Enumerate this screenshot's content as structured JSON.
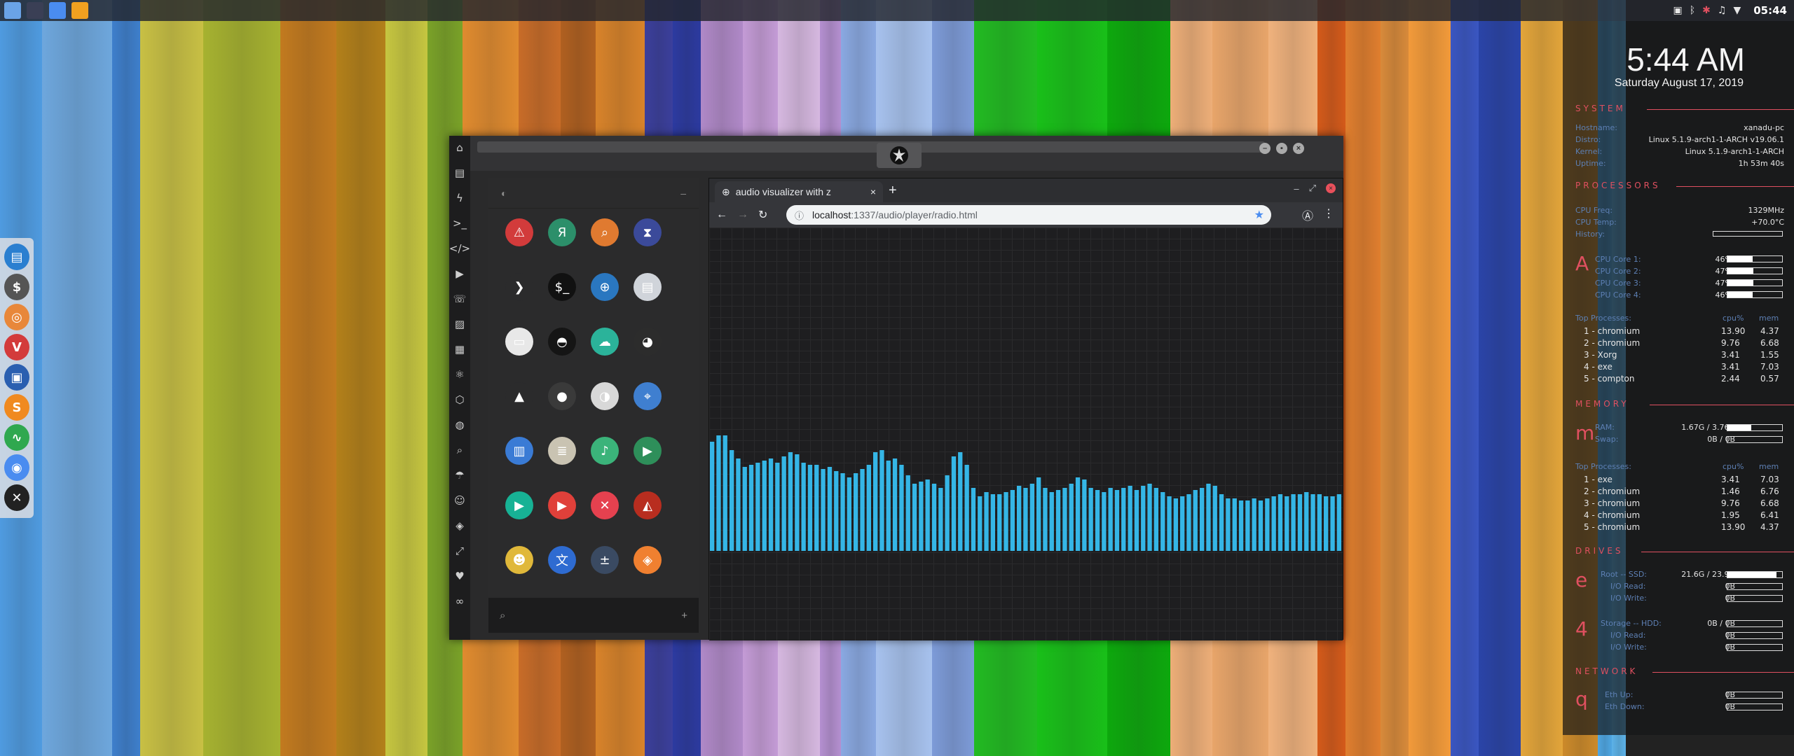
{
  "wallpaper": {
    "stripes": [
      "#4f9be0",
      "#6ea7dd",
      "#3e7fcc",
      "#c8c044",
      "#a6b230",
      "#c27a1f",
      "#b3801a",
      "#c6c640",
      "#7aa228",
      "#e08b2f",
      "#c86c28",
      "#b06020",
      "#d8832a",
      "#3b3f9c",
      "#2c3aa0",
      "#b089c8",
      "#c49bd6",
      "#d6b8e0",
      "#b48fd0",
      "#8aa9e2",
      "#a7c2ee",
      "#7d9bd8",
      "#22bb22",
      "#19c019",
      "#0da80d",
      "#edae78",
      "#e8a56a",
      "#f0b27d",
      "#d45a1a",
      "#e07e2e",
      "#d88a3a",
      "#f29a3a",
      "#3a56c2",
      "#2a44a8",
      "#e3a53a",
      "#cc8a2a",
      "#4ea6e2",
      "#5cb2e8"
    ]
  },
  "top_panel": {
    "apps": [
      {
        "icon": "folder-icon",
        "color": "#6aa3e6"
      },
      {
        "icon": "circle-app-icon",
        "color": "#3a3f55"
      },
      {
        "icon": "chrome-icon",
        "color": "#4a8cf0"
      },
      {
        "icon": "sublime-icon",
        "color": "#f0a020"
      }
    ],
    "tray": [
      "screenshot-icon",
      "bluetooth-icon",
      "settings-icon",
      "volume-icon",
      "wifi-icon"
    ],
    "clock": "05:44"
  },
  "dock": {
    "items": [
      {
        "icon": "files-icon",
        "color": "#2a7fd0",
        "glyph": "▤"
      },
      {
        "icon": "money-icon",
        "color": "#555555",
        "glyph": "$"
      },
      {
        "icon": "ubuntu-icon",
        "color": "#e8873a",
        "glyph": "◎"
      },
      {
        "icon": "vivaldi-icon",
        "color": "#d33b3b",
        "glyph": "V"
      },
      {
        "icon": "screenshot-app-icon",
        "color": "#2a5fb0",
        "glyph": "▣"
      },
      {
        "icon": "sublime-text-icon",
        "color": "#f08a20",
        "glyph": "S"
      },
      {
        "icon": "activity-monitor-icon",
        "color": "#2fa84f",
        "glyph": "∿"
      },
      {
        "icon": "chromium-icon",
        "color": "#4a8cf0",
        "glyph": "◉"
      },
      {
        "icon": "x-app-icon",
        "color": "#222222",
        "glyph": "✕"
      }
    ]
  },
  "conky": {
    "time": "5:44 AM",
    "date": "Saturday August 17, 2019",
    "system": {
      "header": "SYSTEM",
      "rows": [
        {
          "label": "Hostname:",
          "value": "xanadu-pc"
        },
        {
          "label": "Distro:",
          "value": "Linux 5.1.9-arch1-1-ARCH v19.06.1"
        },
        {
          "label": "Kernel:",
          "value": "Linux 5.1.9-arch1-1-ARCH"
        },
        {
          "label": "Uptime:",
          "value": "1h 53m 40s"
        }
      ]
    },
    "processors": {
      "header": "PROCESSORS",
      "freq_label": "CPU Freq:",
      "freq": "1329MHz",
      "temp_label": "CPU Temp:",
      "temp": "+70.0°C",
      "history_label": "History:",
      "big": "A",
      "cores": [
        {
          "label": "CPU Core 1:",
          "value": "46%",
          "level": 0.46
        },
        {
          "label": "CPU Core 2:",
          "value": "47%",
          "level": 0.47
        },
        {
          "label": "CPU Core 3:",
          "value": "47%",
          "level": 0.47
        },
        {
          "label": "CPU Core 4:",
          "value": "46%",
          "level": 0.46
        }
      ],
      "top_label": "Top Processes:",
      "col1": "cpu%",
      "col2": "mem",
      "procs": [
        {
          "n": "1",
          "name": "chromium",
          "a": "13.90",
          "b": "4.37"
        },
        {
          "n": "2",
          "name": "chromium",
          "a": "9.76",
          "b": "6.68"
        },
        {
          "n": "3",
          "name": "Xorg",
          "a": "3.41",
          "b": "1.55"
        },
        {
          "n": "4",
          "name": "exe",
          "a": "3.41",
          "b": "7.03"
        },
        {
          "n": "5",
          "name": "compton",
          "a": "2.44",
          "b": "0.57"
        }
      ]
    },
    "memory": {
      "header": "MEMORY",
      "big": "m",
      "ram_label": "RAM:",
      "ram": "1.67G / 3.76G",
      "ram_level": 0.44,
      "swap_label": "Swap:",
      "swap": "0B / 0B",
      "swap_level": 0,
      "top_label": "Top Processes:",
      "col1": "cpu%",
      "col2": "mem",
      "procs": [
        {
          "n": "1",
          "name": "exe",
          "a": "3.41",
          "b": "7.03"
        },
        {
          "n": "2",
          "name": "chromium",
          "a": "1.46",
          "b": "6.76"
        },
        {
          "n": "3",
          "name": "chromium",
          "a": "9.76",
          "b": "6.68"
        },
        {
          "n": "4",
          "name": "chromium",
          "a": "1.95",
          "b": "6.41"
        },
        {
          "n": "5",
          "name": "chromium",
          "a": "13.90",
          "b": "4.37"
        }
      ]
    },
    "drives": {
      "header": "DRIVES",
      "d1": {
        "big": "e",
        "label": "Root -- SSD:",
        "value": "21.6G / 23.9G",
        "level": 0.9,
        "read_label": "I/O Read:",
        "read": "0B",
        "write_label": "I/O Write:",
        "write": "0B"
      },
      "d2": {
        "big": "4",
        "label": "Storage -- HDD:",
        "value": "0B / 0B",
        "level": 0,
        "read_label": "I/O Read:",
        "read": "0B",
        "write_label": "I/O Write:",
        "write": "0B"
      }
    },
    "network": {
      "header": "NETWORK",
      "big": "q",
      "up_label": "Eth Up:",
      "up": "0B",
      "down_label": "Eth Down:",
      "down": "0B"
    }
  },
  "window": {
    "side_icons": [
      "home-icon",
      "document-icon",
      "bolt-icon",
      "terminal-icon",
      "code-icon",
      "play-icon",
      "contacts-icon",
      "image-icon",
      "news-icon",
      "atom-icon",
      "hexagon-icon",
      "globe-icon",
      "search-icon",
      "umbrella-icon",
      "person-icon",
      "diamond-icon",
      "expand-icon",
      "heart-icon",
      "infinity-icon"
    ],
    "launcher": {
      "top_icon": "◐",
      "top_minus": "–",
      "icons": [
        {
          "name": "warning-app-icon",
          "bg": "#d23b3b",
          "glyph": "⚠"
        },
        {
          "name": "yandex-icon",
          "bg": "#2c8f6a",
          "glyph": "Я"
        },
        {
          "name": "magnifier-app-icon",
          "bg": "#e07a30",
          "glyph": "⌕"
        },
        {
          "name": "hourglass-icon",
          "bg": "#3b4a9a",
          "glyph": "⧗"
        },
        {
          "name": "sublime-launcher-icon",
          "bg": "#2b2b2c",
          "glyph": "❯"
        },
        {
          "name": "terminal-app-icon",
          "bg": "#111111",
          "glyph": "$_"
        },
        {
          "name": "globe-app-icon",
          "bg": "#2a77c0",
          "glyph": "⊕"
        },
        {
          "name": "server-icon",
          "bg": "#d0d4da",
          "glyph": "▤"
        },
        {
          "name": "window-app-icon",
          "bg": "#e8e8e8",
          "glyph": "▭"
        },
        {
          "name": "darth-vader-icon",
          "bg": "#151515",
          "glyph": "◓"
        },
        {
          "name": "cloud-lock-icon",
          "bg": "#2bb39a",
          "glyph": "☁"
        },
        {
          "name": "github-icon",
          "bg": "#2c2c2c",
          "glyph": "◕"
        },
        {
          "name": "starfleet-icon",
          "bg": "#2b2b2c",
          "glyph": "▲"
        },
        {
          "name": "death-star-icon",
          "bg": "#3a3a3a",
          "glyph": "●"
        },
        {
          "name": "moon-icon",
          "bg": "#d8d8d8",
          "glyph": "◑"
        },
        {
          "name": "map-icon",
          "bg": "#3f7fd0",
          "glyph": "⌖"
        },
        {
          "name": "archive-icon",
          "bg": "#3a7bd5",
          "glyph": "▥"
        },
        {
          "name": "notes-icon",
          "bg": "#c9c3b2",
          "glyph": "≣"
        },
        {
          "name": "music-icon",
          "bg": "#3bb37a",
          "glyph": "♪"
        },
        {
          "name": "video-icon",
          "bg": "#2e8f5a",
          "glyph": "▶"
        },
        {
          "name": "play-store-icon",
          "bg": "#17b295",
          "glyph": "▶"
        },
        {
          "name": "youtube-icon",
          "bg": "#e0403a",
          "glyph": "▶"
        },
        {
          "name": "close-app-icon",
          "bg": "#e5414f",
          "glyph": "✕"
        },
        {
          "name": "iron-man-icon",
          "bg": "#b82d1f",
          "glyph": "◭"
        },
        {
          "name": "c3po-icon",
          "bg": "#e0b83a",
          "glyph": "☻"
        },
        {
          "name": "translate-icon",
          "bg": "#2e6bd1",
          "glyph": "文"
        },
        {
          "name": "calculator-icon",
          "bg": "#3a4a62",
          "glyph": "±"
        },
        {
          "name": "photos-icon",
          "bg": "#f08030",
          "glyph": "◈"
        }
      ],
      "search_icon": "⌕",
      "search_plus": "+"
    },
    "browser": {
      "tab_title": "audio visualizer with z",
      "tab_close": "×",
      "new_tab": "+",
      "url_host": "localhost",
      "url_path": ":1337/audio/player/radio.html",
      "bars": [
        0.52,
        0.55,
        0.55,
        0.48,
        0.44,
        0.4,
        0.41,
        0.42,
        0.43,
        0.44,
        0.42,
        0.45,
        0.47,
        0.46,
        0.42,
        0.41,
        0.41,
        0.39,
        0.4,
        0.38,
        0.37,
        0.35,
        0.37,
        0.39,
        0.41,
        0.47,
        0.48,
        0.43,
        0.44,
        0.41,
        0.36,
        0.32,
        0.33,
        0.34,
        0.32,
        0.3,
        0.36,
        0.45,
        0.47,
        0.41,
        0.3,
        0.26,
        0.28,
        0.27,
        0.27,
        0.28,
        0.29,
        0.31,
        0.3,
        0.32,
        0.35,
        0.3,
        0.28,
        0.29,
        0.3,
        0.32,
        0.35,
        0.34,
        0.3,
        0.29,
        0.28,
        0.3,
        0.29,
        0.3,
        0.31,
        0.29,
        0.31,
        0.32,
        0.3,
        0.28,
        0.26,
        0.25,
        0.26,
        0.27,
        0.29,
        0.3,
        0.32,
        0.31,
        0.27,
        0.25,
        0.25,
        0.24,
        0.24,
        0.25,
        0.24,
        0.25,
        0.26,
        0.27,
        0.26,
        0.27,
        0.27,
        0.28,
        0.27,
        0.27,
        0.26,
        0.26,
        0.27
      ]
    }
  }
}
